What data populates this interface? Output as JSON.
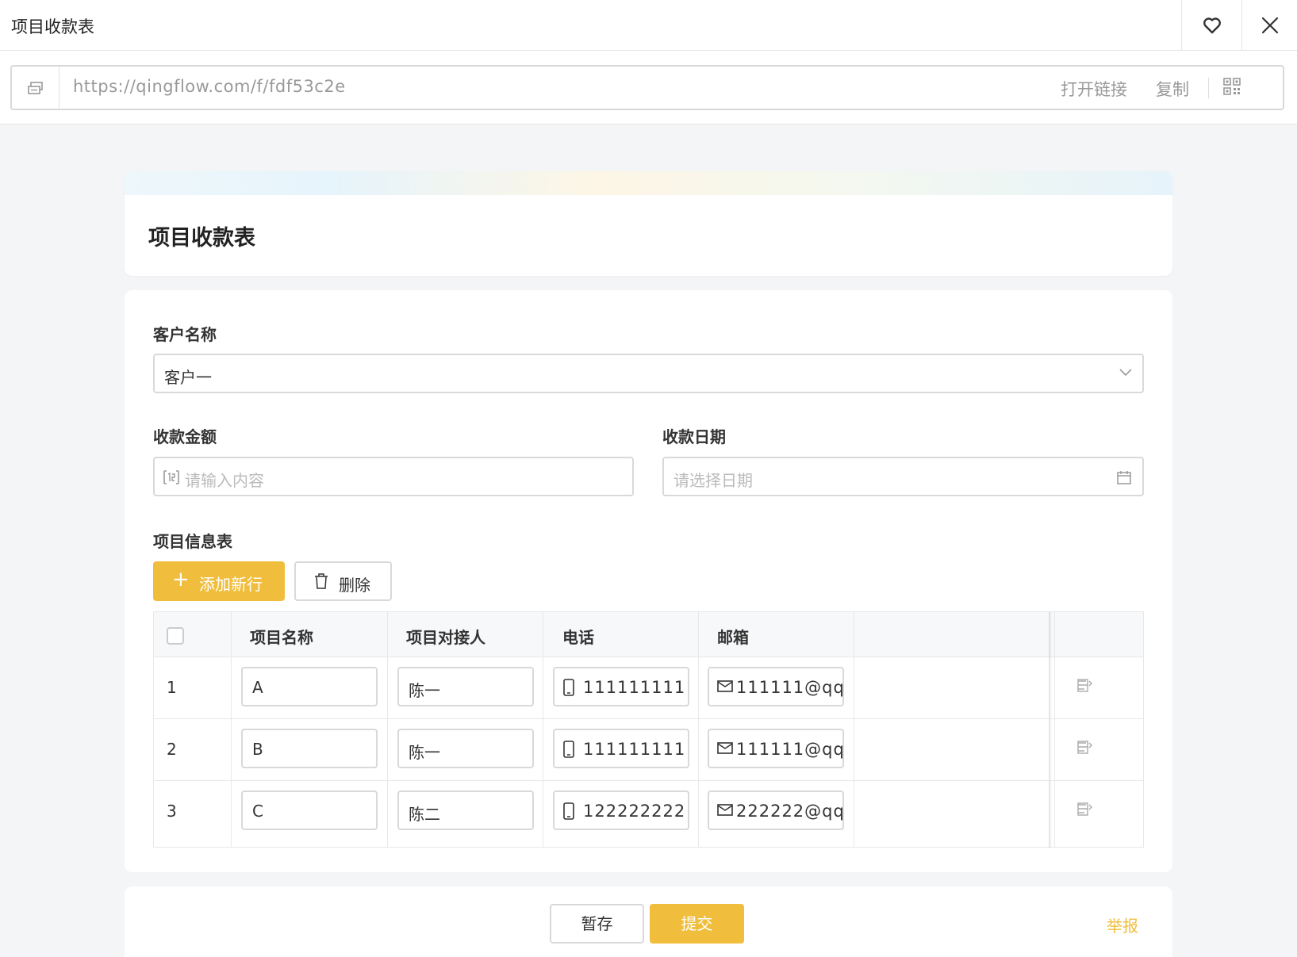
{
  "window": {
    "title": "项目收款表"
  },
  "share": {
    "url": "https://qingflow.com/f/fdf53c2e",
    "open_label": "打开链接",
    "copy_label": "复制"
  },
  "form": {
    "title": "项目收款表",
    "customer": {
      "label": "客户名称",
      "value": "客户一"
    },
    "amount": {
      "label": "收款金额",
      "placeholder": "请输入内容"
    },
    "date": {
      "label": "收款日期",
      "placeholder": "请选择日期"
    },
    "subtable": {
      "label": "项目信息表",
      "add_label": "添加新行",
      "delete_label": "删除",
      "columns": [
        "项目名称",
        "项目对接人",
        "电话",
        "邮箱"
      ],
      "rows": [
        {
          "num": "1",
          "name": "A",
          "contact": "陈一",
          "phone": "111111111",
          "email": "111111@qq"
        },
        {
          "num": "2",
          "name": "B",
          "contact": "陈一",
          "phone": "111111111",
          "email": "111111@qq"
        },
        {
          "num": "3",
          "name": "C",
          "contact": "陈二",
          "phone": "122222222",
          "email": "222222@qq"
        }
      ]
    }
  },
  "footer": {
    "save_label": "暂存",
    "submit_label": "提交",
    "report_label": "举报"
  },
  "colors": {
    "accent": "#f0be3c",
    "border": "#d9d9d9",
    "background": "#f4f5f7"
  }
}
